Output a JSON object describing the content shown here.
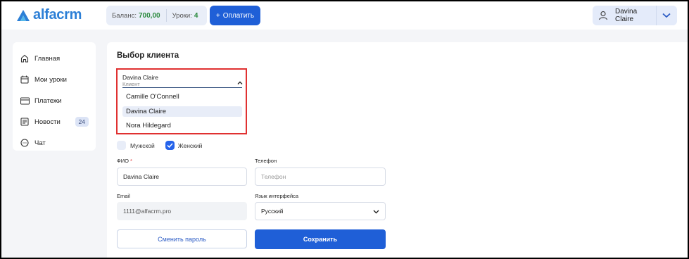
{
  "header": {
    "logo_text": "alfacrm",
    "balance_label": "Баланс:",
    "balance_value": "700,00",
    "lessons_label": "Уроки:",
    "lessons_value": "4",
    "pay_label": "Оплатить",
    "user_name": "Davina Claire"
  },
  "sidebar": {
    "items": [
      {
        "label": "Главная",
        "icon": "home-icon"
      },
      {
        "label": "Мои уроки",
        "icon": "calendar-icon"
      },
      {
        "label": "Платежи",
        "icon": "card-icon"
      },
      {
        "label": "Новости",
        "icon": "news-icon",
        "badge": "24"
      },
      {
        "label": "Чат",
        "icon": "chat-icon"
      }
    ]
  },
  "main": {
    "title": "Выбор клиента",
    "client_select": {
      "value": "Davina Claire",
      "sublabel": "Клиент",
      "options": [
        "Camille O'Connell",
        "Davina Claire",
        "Nora Hildegard"
      ],
      "selected": "Davina Claire"
    },
    "gender": {
      "male": "Мужской",
      "female": "Женский",
      "checked": "female"
    },
    "fio_label": "ФИО",
    "fio_required": "*",
    "fio_value": "Davina Claire",
    "phone_label": "Телефон",
    "phone_placeholder": "Телефон",
    "email_label": "Email",
    "email_value": "1111@alfacrm.pro",
    "lang_label": "Язык интерфейса",
    "lang_value": "Русский",
    "change_password": "Сменить пароль",
    "save": "Сохранить"
  },
  "colors": {
    "accent": "#1f5fd7",
    "highlight": "#e03131",
    "balance": "#2b8a3e"
  }
}
